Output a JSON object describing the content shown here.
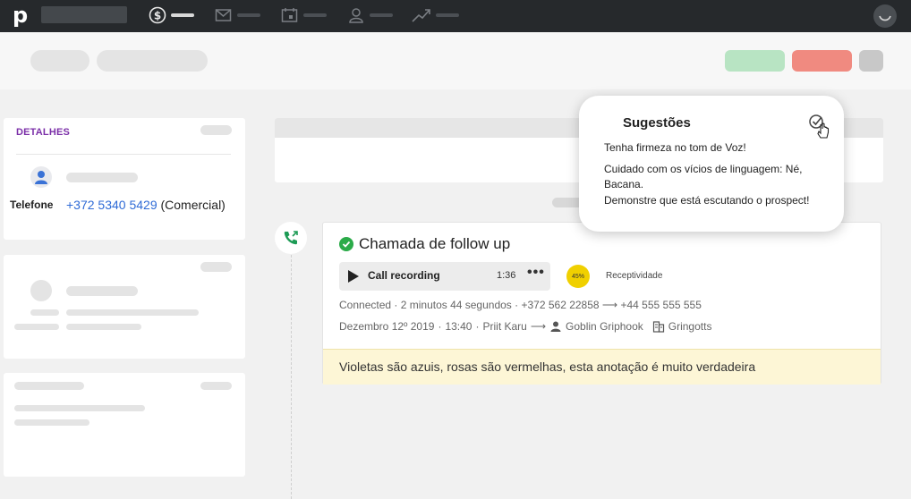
{
  "nav": {
    "logo": "p",
    "items": [
      {
        "icon": "dollar-icon",
        "active": true
      },
      {
        "icon": "mail-icon",
        "active": false
      },
      {
        "icon": "calendar-icon",
        "active": false
      },
      {
        "icon": "contacts-icon",
        "active": false
      },
      {
        "icon": "trending-icon",
        "active": false
      }
    ]
  },
  "header": {
    "accent_colors": {
      "won": "#b8e4c3",
      "lost": "#f08a80",
      "more": "#c8c8c8"
    }
  },
  "details": {
    "title": "DETALHES",
    "phone_label": "Telefone",
    "phone_number": "+372 5340 5429",
    "phone_type": "(Comercial)"
  },
  "activity": {
    "title": "Chamada de follow up",
    "recording_label": "Call recording",
    "recording_time": "1:36",
    "more": "•••",
    "score": "45%",
    "score_label": "Receptividade",
    "status": "Connected",
    "duration": "2 minutos 44 segundos",
    "from_number": "+372 562 22858",
    "to_number": "+44 555 555 555",
    "date": "Dezembro 12º 2019",
    "time": "13:40",
    "owner": "Priit Karu",
    "contact": "Goblin Griphook",
    "organization": "Gringotts",
    "note": "Violetas são azuis, rosas são vermelhas, esta anotação é muito verdadeira"
  },
  "suggestions": {
    "title": "Sugestões",
    "items": [
      "Tenha firmeza no tom de Voz!",
      "Cuidado com os vícios de linguagem: Né, Bacana.",
      "Demonstre que está escutando o prospect!"
    ]
  }
}
